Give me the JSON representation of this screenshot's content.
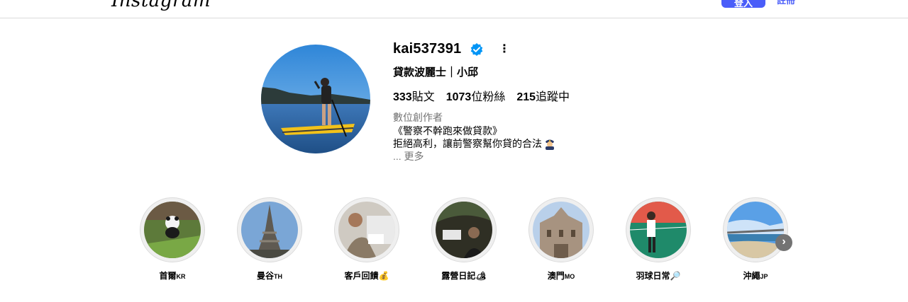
{
  "header": {
    "logo": "Instagram",
    "login_label": "登入",
    "signup_label": "註冊"
  },
  "profile": {
    "username": "kai537391",
    "full_name": "貸款波麗士｜小邱",
    "stats": {
      "posts_count": "333",
      "posts_label": "貼文",
      "followers_count": "1073",
      "followers_label": "位粉絲",
      "following_count": "215",
      "following_label": "追蹤中"
    },
    "category": "數位創作者",
    "bio_line1": "《警察不幹跑來做貸款》",
    "bio_line2": "拒絕高利，讓前警察幫你貸的合法",
    "bio_more": "... 更多"
  },
  "highlights": [
    {
      "name": "首爾",
      "suffix": "KR"
    },
    {
      "name": "曼谷",
      "suffix": "TH"
    },
    {
      "name": "客戶回饋",
      "suffix": ""
    },
    {
      "name": "露營日記",
      "suffix": ""
    },
    {
      "name": "澳門",
      "suffix": "MO"
    },
    {
      "name": "羽球日常",
      "suffix": ""
    },
    {
      "name": "沖繩",
      "suffix": "JP"
    }
  ],
  "colors": {
    "accent": "#4a5df9",
    "verified": "#0095f6",
    "muted_text": "#737373",
    "border": "#dbdbdb"
  },
  "icons": {
    "verified": "verified-badge-icon",
    "options": "more-options-icon",
    "next": "chevron-right-icon"
  }
}
